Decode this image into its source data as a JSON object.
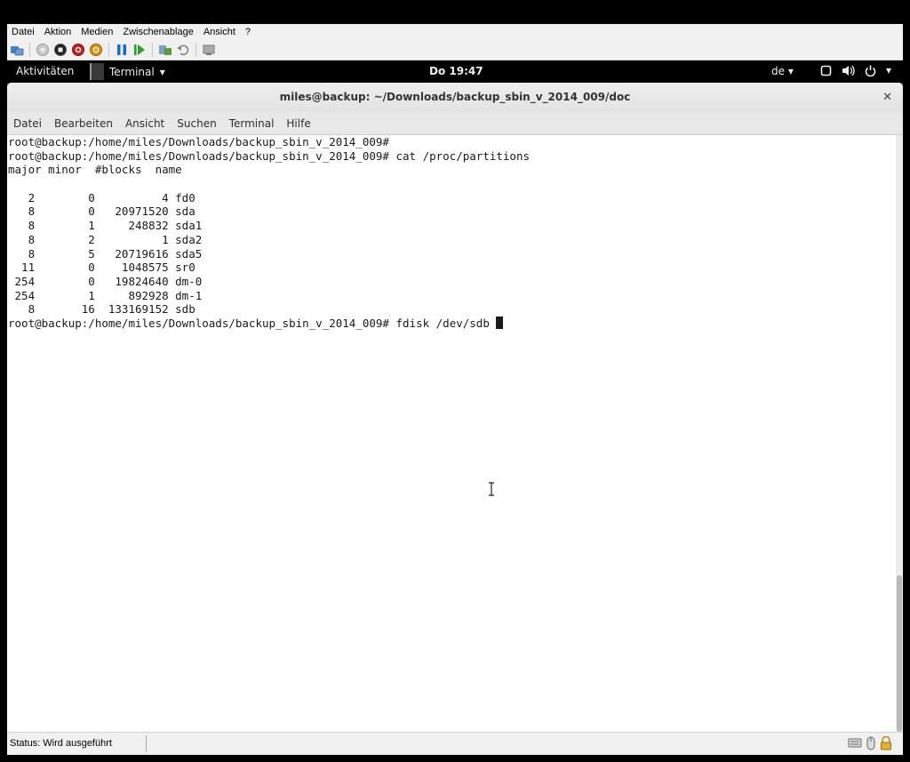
{
  "host": {
    "menu": [
      "Datei",
      "Aktion",
      "Medien",
      "Zwischenablage",
      "Ansicht",
      "?"
    ],
    "toolbar": [
      "ctrl-alt-del-icon",
      "start-icon",
      "turnoff-icon",
      "shutdown-icon",
      "power-icon",
      "pause-icon",
      "resume-icon",
      "checkpoint-icon",
      "revert-icon",
      "enhanced-session-icon"
    ],
    "status": "Status: Wird ausgeführt"
  },
  "gnome": {
    "activities": "Aktivitäten",
    "app_menu": "Terminal",
    "clock": "Do 19:47",
    "lang": "de"
  },
  "terminal": {
    "title": "miles@backup: ~/Downloads/backup_sbin_v_2014_009/doc",
    "menu": [
      "Datei",
      "Bearbeiten",
      "Ansicht",
      "Suchen",
      "Terminal",
      "Hilfe"
    ],
    "lines": [
      "root@backup:/home/miles/Downloads/backup_sbin_v_2014_009#",
      "root@backup:/home/miles/Downloads/backup_sbin_v_2014_009# cat /proc/partitions",
      "major minor  #blocks  name",
      "",
      "   2        0          4 fd0",
      "   8        0   20971520 sda",
      "   8        1     248832 sda1",
      "   8        2          1 sda2",
      "   8        5   20719616 sda5",
      "  11        0    1048575 sr0",
      " 254        0   19824640 dm-0",
      " 254        1     892928 dm-1",
      "   8       16  133169152 sdb"
    ],
    "prompt": "root@backup:/home/miles/Downloads/backup_sbin_v_2014_009# fdisk /dev/sdb "
  }
}
